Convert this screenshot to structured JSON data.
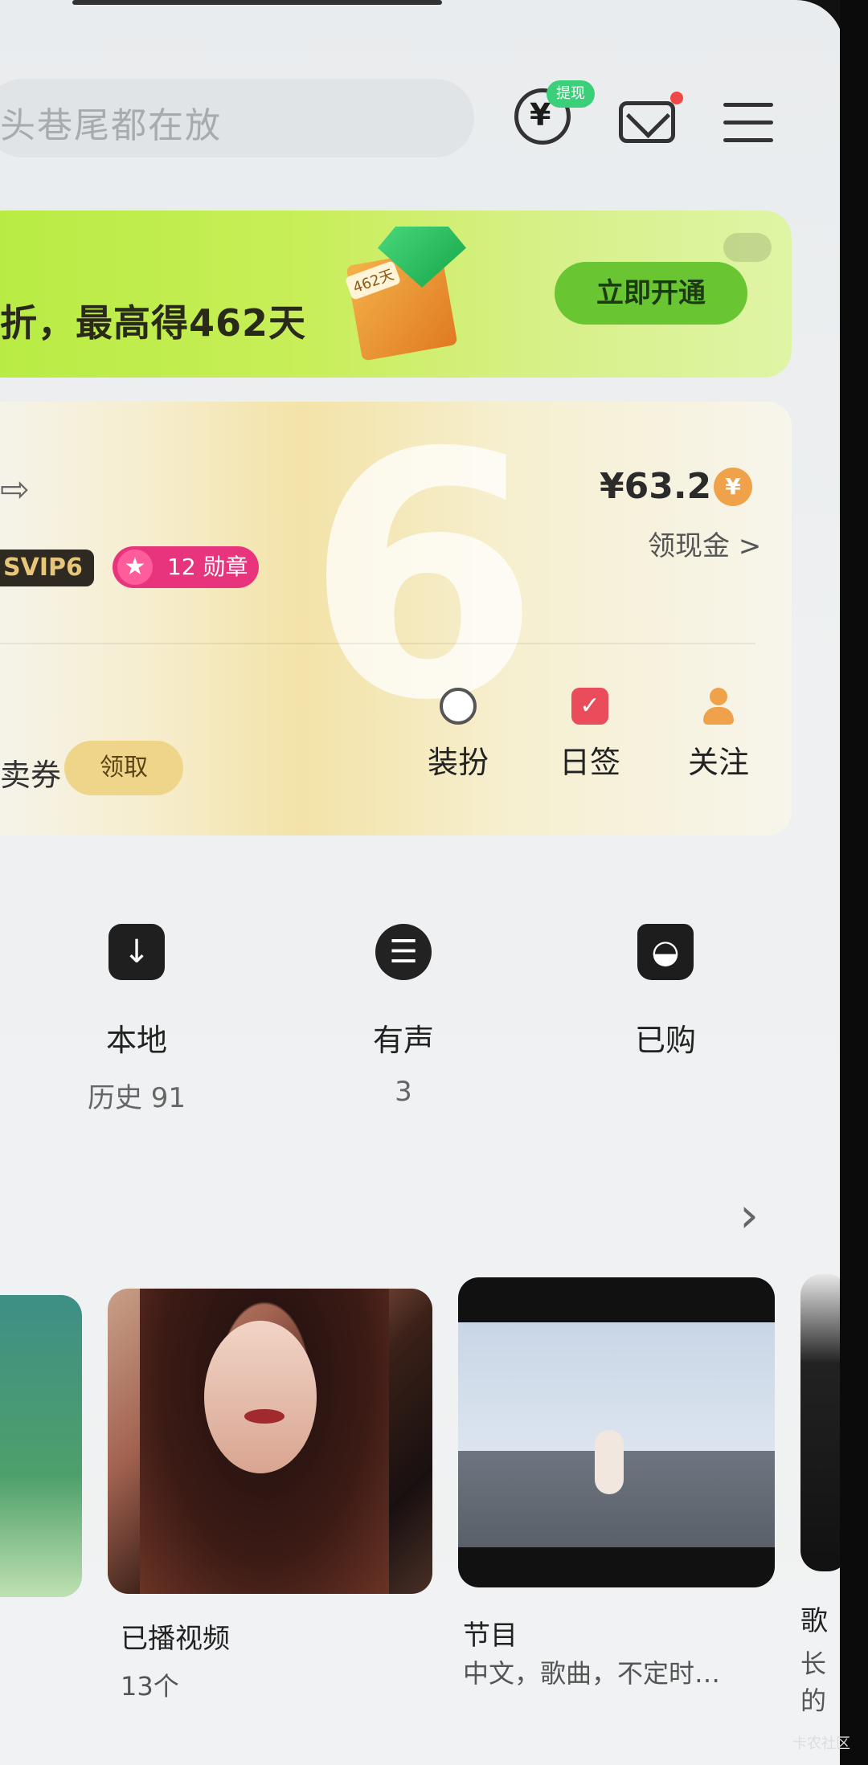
{
  "search": {
    "placeholder": "头巷尾都在放"
  },
  "header": {
    "wallet_badge": "提现"
  },
  "vip_banner": {
    "promo_text": "折，最高得462天",
    "gift_tag": "462天",
    "button": "立即开通"
  },
  "account_card": {
    "svip_level": "SVIP6",
    "medal_text": "12 勋章",
    "balance": "¥63.2",
    "coin_symbol": "¥",
    "cash_link": "领现金 >",
    "coupon_label": "卖券",
    "coupon_button": "领取",
    "quick_actions": [
      {
        "label": "装扮",
        "icon": "panda-icon"
      },
      {
        "label": "日签",
        "icon": "check-icon"
      },
      {
        "label": "关注",
        "icon": "user-add-icon"
      }
    ]
  },
  "tools": [
    {
      "label": "本地",
      "sub": "历史 91",
      "icon": "download-icon"
    },
    {
      "label": "有声",
      "sub": "3",
      "icon": "headphones-icon"
    },
    {
      "label": "已购",
      "sub": "",
      "icon": "bag-icon"
    }
  ],
  "cards": [
    {
      "title": "已播视频",
      "sub": "13个"
    },
    {
      "title": "节目",
      "sub": "中文，歌曲，不定时…"
    },
    {
      "title": "歌",
      "sub": "长的"
    }
  ],
  "watermark": "卡农社区",
  "colors": {
    "accent_green": "#69c532",
    "medal_pink": "#e8347d",
    "coin_orange": "#f0a24a"
  }
}
